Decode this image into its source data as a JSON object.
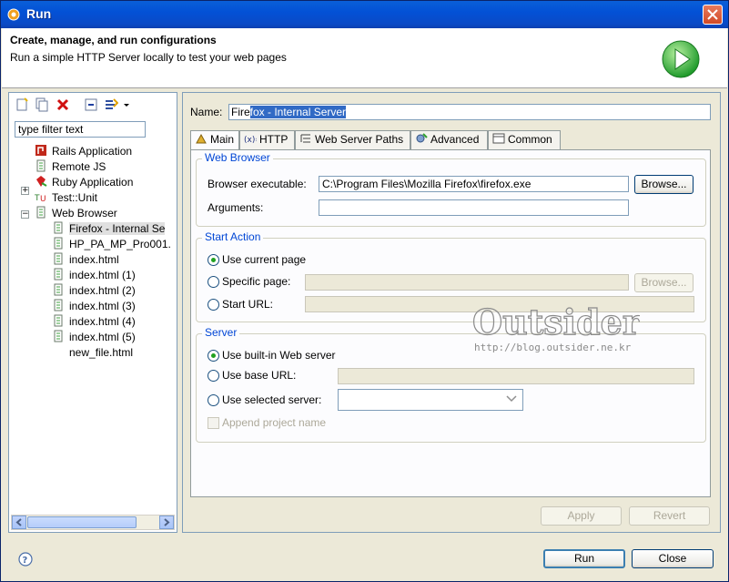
{
  "window": {
    "title": "Run"
  },
  "header": {
    "title": "Create, manage, and run configurations",
    "subtitle": "Run a simple HTTP Server locally to test your web pages"
  },
  "left": {
    "filter_placeholder": "type filter text",
    "tree": [
      {
        "label": "Rails Application"
      },
      {
        "label": "Remote JS"
      },
      {
        "label": "Ruby Application"
      },
      {
        "label": "Test::Unit"
      },
      {
        "label": "Web Browser"
      },
      {
        "label": "Firefox - Internal Se"
      },
      {
        "label": "HP_PA_MP_Pro001."
      },
      {
        "label": "index.html"
      },
      {
        "label": "index.html (1)"
      },
      {
        "label": "index.html (2)"
      },
      {
        "label": "index.html (3)"
      },
      {
        "label": "index.html (4)"
      },
      {
        "label": "index.html (5)"
      },
      {
        "label": "new_file.html"
      }
    ]
  },
  "form": {
    "name_label": "Name:",
    "name_value_plain": "Fire",
    "name_value_selected": "fox - Internal Server",
    "tabs": [
      "Main",
      "HTTP",
      "Web Server Paths",
      "Advanced",
      "Common"
    ],
    "web_browser_group": "Web Browser",
    "browser_exec_label": "Browser executable:",
    "browser_exec_value": "C:\\Program Files\\Mozilla Firefox\\firefox.exe",
    "browse_label": "Browse...",
    "arguments_label": "Arguments:",
    "start_action_group": "Start Action",
    "use_current_page": "Use current page",
    "specific_page": "Specific page:",
    "start_url": "Start URL:",
    "server_group": "Server",
    "use_builtin": "Use built-in Web server",
    "use_base_url": "Use base URL:",
    "use_selected_server": "Use selected server:",
    "append_project_name": "Append project name"
  },
  "buttons": {
    "apply": "Apply",
    "revert": "Revert",
    "run": "Run",
    "close": "Close"
  },
  "watermark": {
    "logo": "Outsider",
    "url": "http://blog.outsider.ne.kr"
  }
}
